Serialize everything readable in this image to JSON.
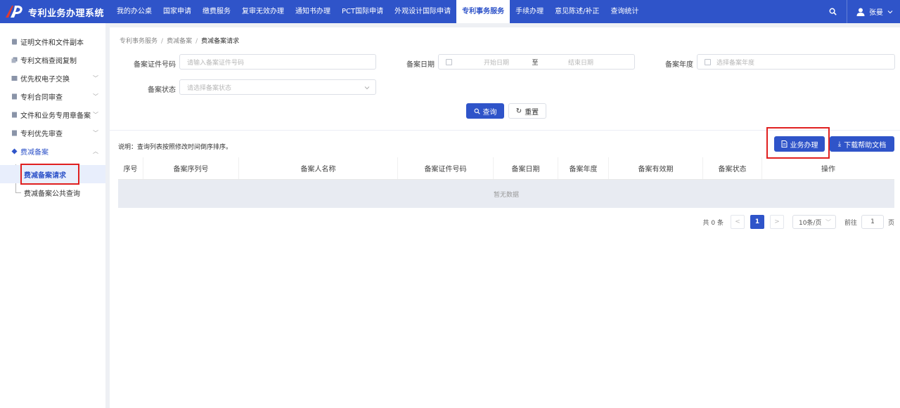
{
  "app": {
    "title": "专利业务办理系统"
  },
  "nav": {
    "items": [
      {
        "label": "我的办公桌"
      },
      {
        "label": "国家申请"
      },
      {
        "label": "缴费服务"
      },
      {
        "label": "复审无效办理"
      },
      {
        "label": "通知书办理"
      },
      {
        "label": "PCT国际申请"
      },
      {
        "label": "外观设计国际申请"
      },
      {
        "label": "专利事务服务",
        "active": true
      },
      {
        "label": "手续办理"
      },
      {
        "label": "意见陈述/补正"
      },
      {
        "label": "查询统计"
      }
    ]
  },
  "user": {
    "name": "张曼"
  },
  "sidebar": {
    "items": [
      {
        "label": "证明文件和文件副本"
      },
      {
        "label": "专利文档查阅复制"
      },
      {
        "label": "优先权电子交换"
      },
      {
        "label": "专利合同审查"
      },
      {
        "label": "文件和业务专用章备案"
      },
      {
        "label": "专利优先审查"
      },
      {
        "label": "费减备案"
      }
    ],
    "subitems": [
      {
        "label": "费减备案请求",
        "active": true
      },
      {
        "label": "费减备案公共查询"
      }
    ]
  },
  "breadcrumb": {
    "items": [
      "专利事务服务",
      "费减备案",
      "费减备案请求"
    ]
  },
  "form": {
    "cert_label": "备案证件号码",
    "cert_placeholder": "请输入备案证件号码",
    "date_label": "备案日期",
    "date_start": "开始日期",
    "date_sep": "至",
    "date_end": "结束日期",
    "year_label": "备案年度",
    "year_placeholder": "选择备案年度",
    "status_label": "备案状态",
    "status_placeholder": "请选择备案状态",
    "query_btn": "查询",
    "reset_btn": "重置"
  },
  "note": "说明：查询列表按照修改时间倒序排序。",
  "actions": {
    "business": "业务办理",
    "download": "下载帮助文档"
  },
  "table": {
    "columns": [
      "序号",
      "备案序列号",
      "备案人名称",
      "备案证件号码",
      "备案日期",
      "备案年度",
      "备案有效期",
      "备案状态",
      "操作"
    ],
    "empty": "暂无数据"
  },
  "pager": {
    "total": "共 0 条",
    "current": "1",
    "page_size": "10条/页",
    "goto": "前往",
    "page_input": "1",
    "page_unit": "页"
  },
  "colors": {
    "primary": "#2f54c9",
    "highlight": "#e02020"
  }
}
